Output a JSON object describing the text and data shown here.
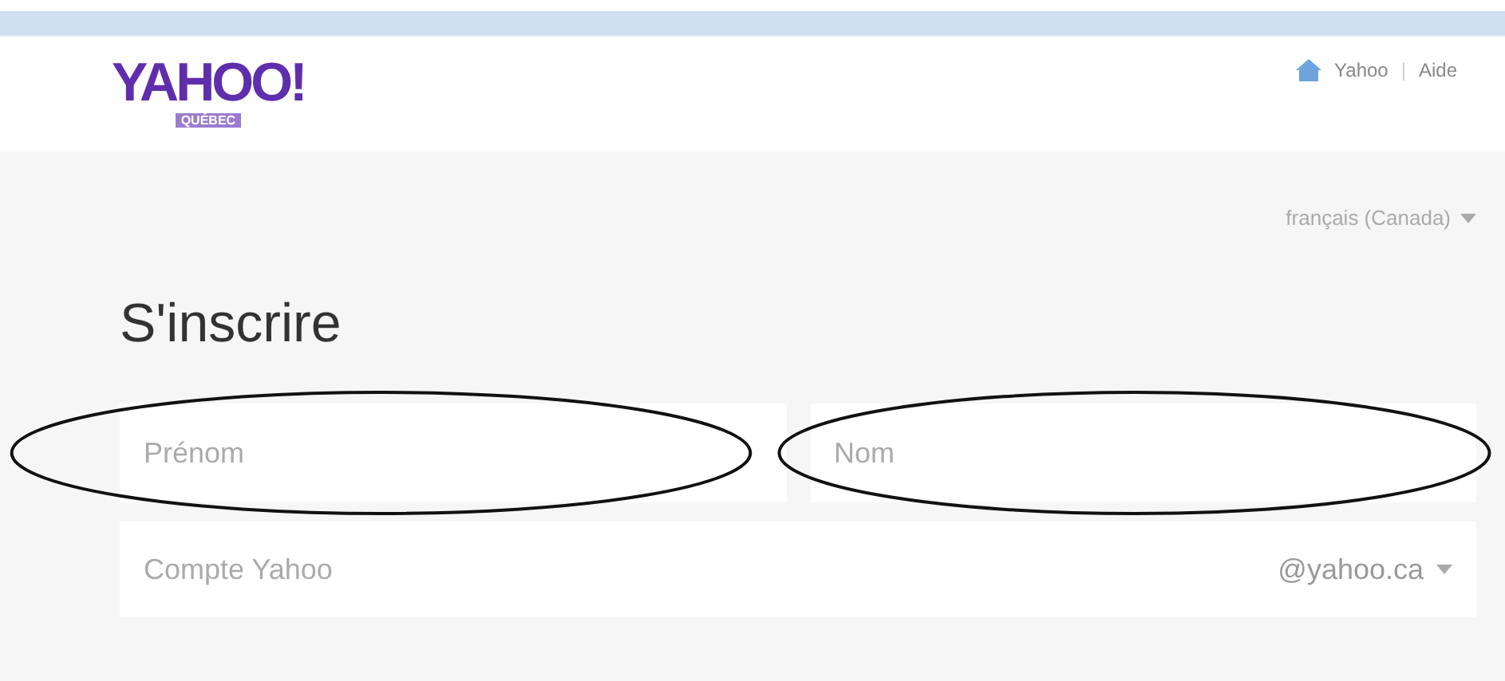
{
  "header": {
    "logo": "YAHOO!",
    "logo_region": "QUÉBEC",
    "links": [
      {
        "label": "Yahoo",
        "kind": "home"
      },
      {
        "label": "|",
        "kind": "separator"
      },
      {
        "label": "Aide",
        "kind": "link"
      }
    ]
  },
  "language": {
    "label": "français (Canada)"
  },
  "title": "S'inscrire",
  "name_fields": [
    {
      "placeholder": "Prénom",
      "circled": true
    },
    {
      "placeholder": "Nom",
      "circled": true
    }
  ],
  "account_field": {
    "placeholder": "Compte Yahoo",
    "domain": "@yahoo.ca"
  }
}
